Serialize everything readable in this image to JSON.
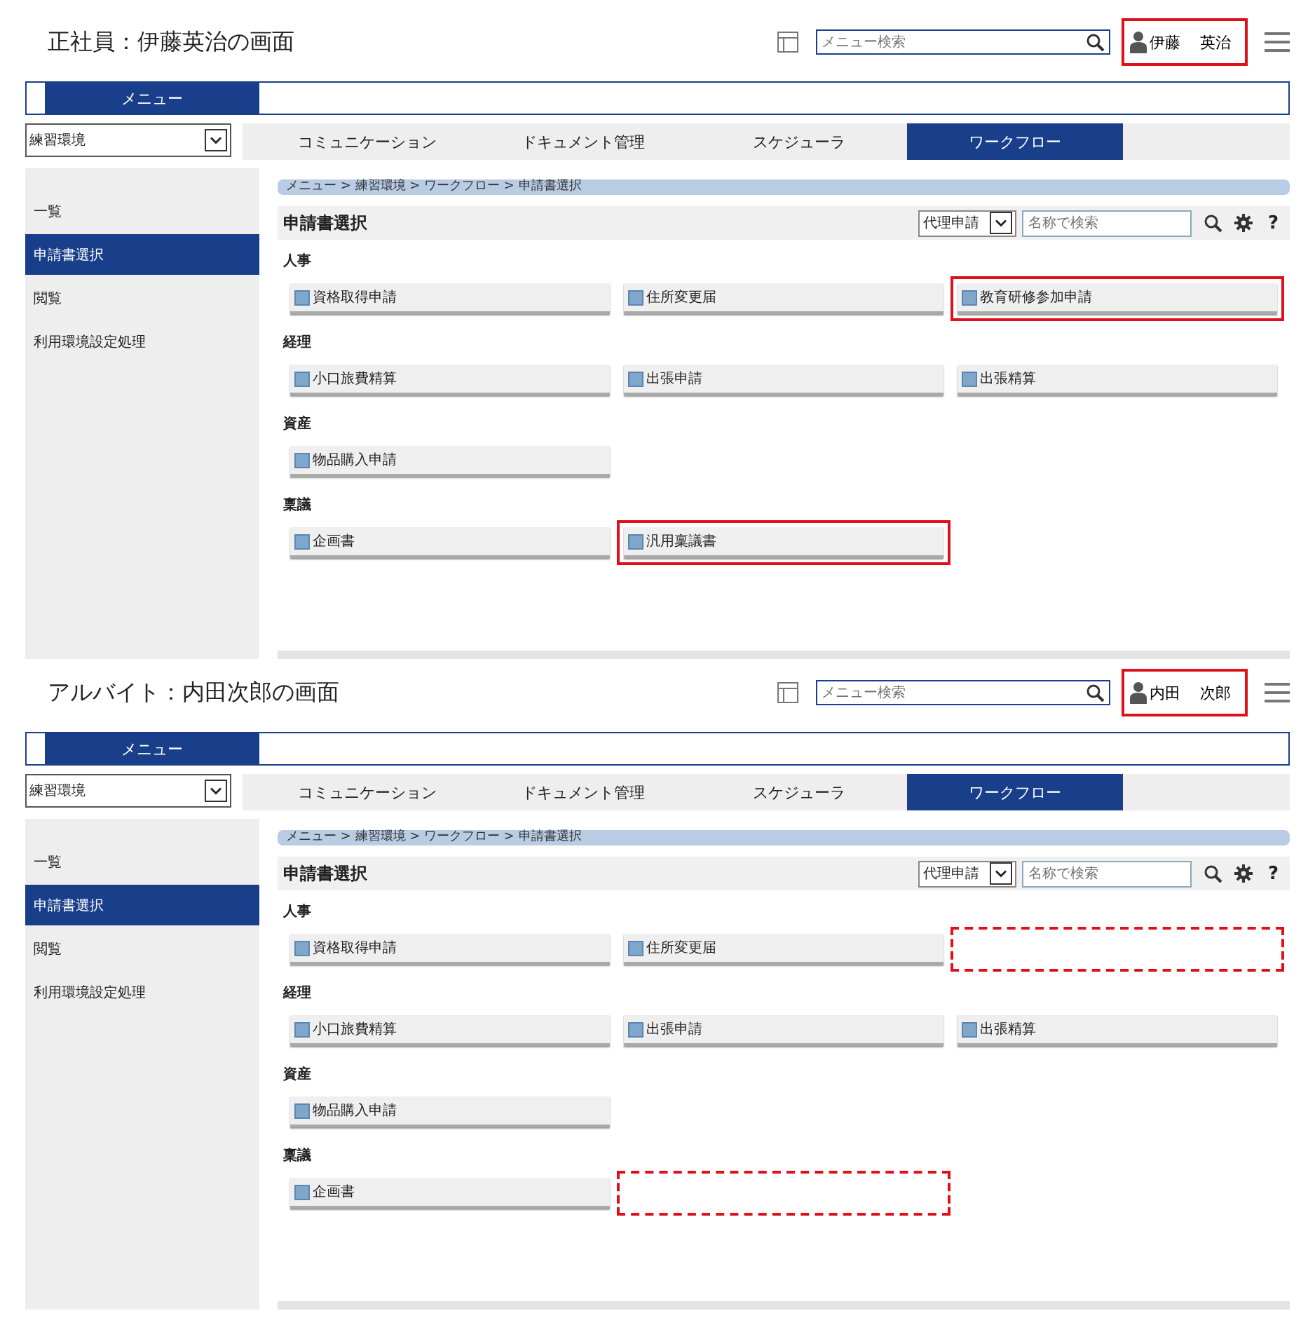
{
  "screens": [
    {
      "caption": "正社員：伊藤英治の画面",
      "search": {
        "placeholder": "メニュー検索"
      },
      "user": {
        "family_name": "伊藤",
        "given_name": "英治",
        "highlighted": true
      },
      "menu_label": "メニュー",
      "env_select": "練習環境",
      "tabs": [
        {
          "label": "コミュニケーション",
          "selected": false
        },
        {
          "label": "ドキュメント管理",
          "selected": false
        },
        {
          "label": "スケジューラ",
          "selected": false
        },
        {
          "label": "ワークフロー",
          "selected": true
        }
      ],
      "sidebar": [
        {
          "label": "一覧",
          "selected": false
        },
        {
          "label": "申請書選択",
          "selected": true
        },
        {
          "label": "閲覧",
          "selected": false
        },
        {
          "label": "利用環境設定処理",
          "selected": false
        }
      ],
      "breadcrumb": "メニュー > 練習環境 > ワークフロー > 申請書選択",
      "page_title": "申請書選択",
      "proxy_select": "代理申請",
      "name_search": {
        "placeholder": "名称で検索"
      },
      "help": "?",
      "categories": [
        {
          "name": "人事",
          "forms": [
            {
              "kind": "form",
              "label": "資格取得申請",
              "highlighted": false
            },
            {
              "kind": "form",
              "label": "住所変更届",
              "highlighted": false
            },
            {
              "kind": "form",
              "label": "教育研修参加申請",
              "highlighted": true
            }
          ]
        },
        {
          "name": "経理",
          "forms": [
            {
              "kind": "form",
              "label": "小口旅費精算",
              "highlighted": false
            },
            {
              "kind": "form",
              "label": "出張申請",
              "highlighted": false
            },
            {
              "kind": "form",
              "label": "出張精算",
              "highlighted": false
            }
          ]
        },
        {
          "name": "資産",
          "forms": [
            {
              "kind": "form",
              "label": "物品購入申請",
              "highlighted": false
            }
          ]
        },
        {
          "name": "稟議",
          "forms": [
            {
              "kind": "form",
              "label": "企画書",
              "highlighted": false
            },
            {
              "kind": "form",
              "label": "汎用稟議書",
              "highlighted": true
            }
          ]
        }
      ]
    },
    {
      "caption": "アルバイト：内田次郎の画面",
      "search": {
        "placeholder": "メニュー検索"
      },
      "user": {
        "family_name": "内田",
        "given_name": "次郎",
        "highlighted": true
      },
      "menu_label": "メニュー",
      "env_select": "練習環境",
      "tabs": [
        {
          "label": "コミュニケーション",
          "selected": false
        },
        {
          "label": "ドキュメント管理",
          "selected": false
        },
        {
          "label": "スケジューラ",
          "selected": false
        },
        {
          "label": "ワークフロー",
          "selected": true
        }
      ],
      "sidebar": [
        {
          "label": "一覧",
          "selected": false
        },
        {
          "label": "申請書選択",
          "selected": true
        },
        {
          "label": "閲覧",
          "selected": false
        },
        {
          "label": "利用環境設定処理",
          "selected": false
        }
      ],
      "breadcrumb": "メニュー > 練習環境 > ワークフロー > 申請書選択",
      "page_title": "申請書選択",
      "proxy_select": "代理申請",
      "name_search": {
        "placeholder": "名称で検索"
      },
      "help": "?",
      "categories": [
        {
          "name": "人事",
          "forms": [
            {
              "kind": "form",
              "label": "資格取得申請",
              "highlighted": false
            },
            {
              "kind": "form",
              "label": "住所変更届",
              "highlighted": false
            },
            {
              "kind": "missing"
            }
          ]
        },
        {
          "name": "経理",
          "forms": [
            {
              "kind": "form",
              "label": "小口旅費精算",
              "highlighted": false
            },
            {
              "kind": "form",
              "label": "出張申請",
              "highlighted": false
            },
            {
              "kind": "form",
              "label": "出張精算",
              "highlighted": false
            }
          ]
        },
        {
          "name": "資産",
          "forms": [
            {
              "kind": "form",
              "label": "物品購入申請",
              "highlighted": false
            }
          ]
        },
        {
          "name": "稟議",
          "forms": [
            {
              "kind": "form",
              "label": "企画書",
              "highlighted": false
            },
            {
              "kind": "missing"
            }
          ]
        }
      ]
    }
  ]
}
